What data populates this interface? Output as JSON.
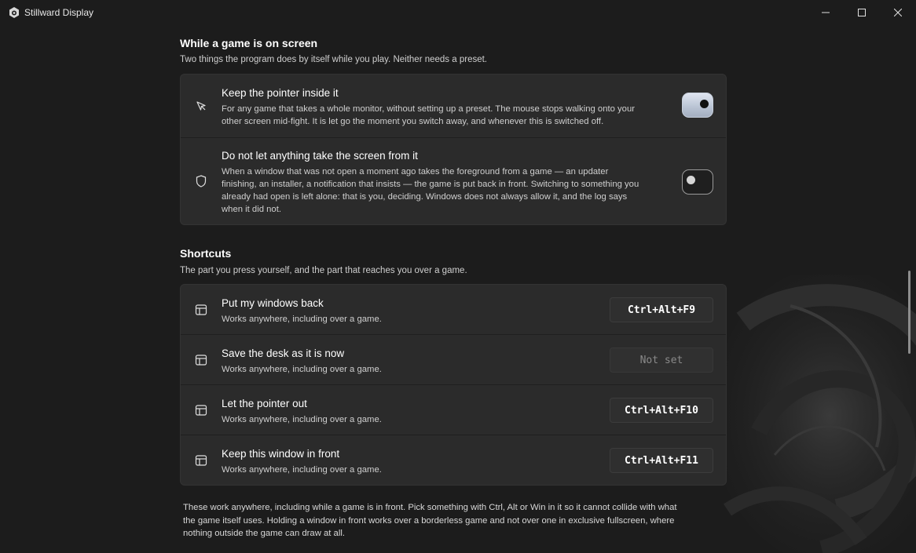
{
  "window": {
    "title": "Stillward Display",
    "controls": [
      "minimize",
      "maximize",
      "close"
    ]
  },
  "game_section": {
    "title": "While a game is on screen",
    "subtitle": "Two things the program does by itself while you play. Neither needs a preset.",
    "items": [
      {
        "icon": "pointer-icon",
        "title": "Keep the pointer inside it",
        "desc_lines": [
          "For any game that takes a whole monitor, without setting up a preset. The mouse stops walking onto your",
          "other screen mid-fight. It is let go the moment you switch away, and whenever this is switched off."
        ],
        "toggle": "on"
      },
      {
        "icon": "shield-icon",
        "title": "Do not let anything take the screen from it",
        "desc_lines": [
          "When a window that was not open a moment ago takes the foreground from a game — an updater",
          "finishing, an installer, a notification that insists — the game is put back in front. Switching to something you",
          "already had open is left alone: that is you, deciding. Windows does not always allow it, and the log says",
          "when it did not."
        ],
        "toggle": "off"
      }
    ]
  },
  "shortcuts_section": {
    "title": "Shortcuts",
    "subtitle": "The part you press yourself, and the part that reaches you over a game.",
    "items": [
      {
        "icon": "layout-icon",
        "title": "Put my windows back",
        "desc": "Works anywhere, including over a game.",
        "key": "Ctrl+Alt+F9",
        "set": true
      },
      {
        "icon": "layout-icon",
        "title": "Save the desk as it is now",
        "desc": "Works anywhere, including over a game.",
        "key": "Not set",
        "set": false
      },
      {
        "icon": "layout-icon",
        "title": "Let the pointer out",
        "desc": "Works anywhere, including over a game.",
        "key": "Ctrl+Alt+F10",
        "set": true
      },
      {
        "icon": "layout-icon",
        "title": "Keep this window in front",
        "desc": "Works anywhere, including over a game.",
        "key": "Ctrl+Alt+F11",
        "set": true
      }
    ],
    "footer_lines": [
      "These work anywhere, including while a game is in front. Pick something with Ctrl, Alt or Win in it so it cannot collide with what",
      "the game itself uses. Holding a window in front works over a borderless game and not over one in exclusive fullscreen, where",
      "nothing outside the game can draw at all."
    ]
  },
  "colors": {
    "background": "#1c1c1c",
    "card": "#2b2b2b",
    "toggle_on": "#c3ccda",
    "text_secondary": "#cfcfcf"
  }
}
